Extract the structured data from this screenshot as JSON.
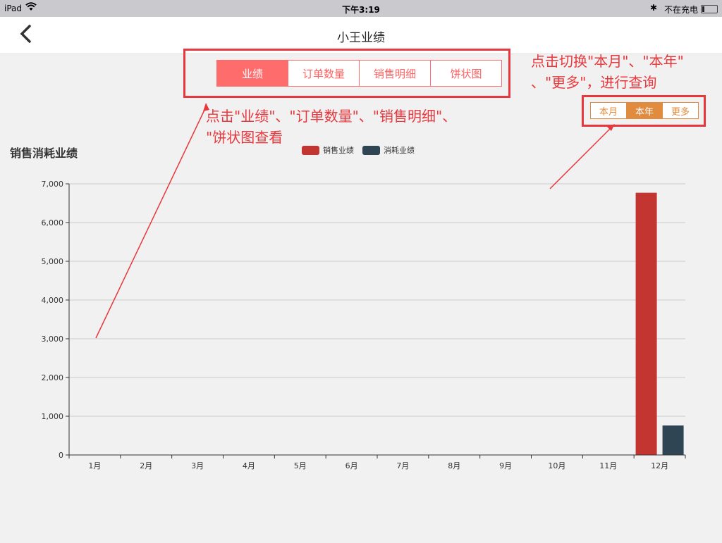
{
  "status_bar": {
    "device": "iPad",
    "time": "下午3:19",
    "battery_text": "不在充电"
  },
  "nav": {
    "title": "小王业绩"
  },
  "tabs": [
    {
      "label": "业绩",
      "active": true
    },
    {
      "label": "订单数量",
      "active": false
    },
    {
      "label": "销售明细",
      "active": false
    },
    {
      "label": "饼状图",
      "active": false
    }
  ],
  "period_tabs": [
    {
      "label": "本月",
      "active": false
    },
    {
      "label": "本年",
      "active": true
    },
    {
      "label": "更多",
      "active": false
    }
  ],
  "annotations": {
    "tabs_hint_line1": "点击\"业绩\"、\"订单数量\"、\"销售明细\"、",
    "tabs_hint_line2": "\"饼状图查看",
    "period_hint_line1": "点击切换\"本月\"、\"本年\"",
    "period_hint_line2": "、\"更多\"，进行查询",
    "color": "#e8383d"
  },
  "chart_title": "销售消耗业绩",
  "chart_data": {
    "type": "bar",
    "categories": [
      "1月",
      "2月",
      "3月",
      "4月",
      "5月",
      "6月",
      "7月",
      "8月",
      "9月",
      "10月",
      "11月",
      "12月"
    ],
    "series": [
      {
        "name": "销售业绩",
        "color": "#c23531",
        "values": [
          0,
          0,
          0,
          0,
          0,
          0,
          0,
          0,
          0,
          0,
          0,
          6770
        ]
      },
      {
        "name": "消耗业绩",
        "color": "#2f4554",
        "values": [
          0,
          0,
          0,
          0,
          0,
          0,
          0,
          0,
          0,
          0,
          0,
          760
        ]
      }
    ],
    "ylim": [
      0,
      7000
    ],
    "yticks": [
      0,
      1000,
      2000,
      3000,
      4000,
      5000,
      6000,
      7000
    ],
    "ytick_labels": [
      "0",
      "1,000",
      "2,000",
      "3,000",
      "4,000",
      "5,000",
      "6,000",
      "7,000"
    ],
    "grid": true,
    "legend": "top-center"
  }
}
